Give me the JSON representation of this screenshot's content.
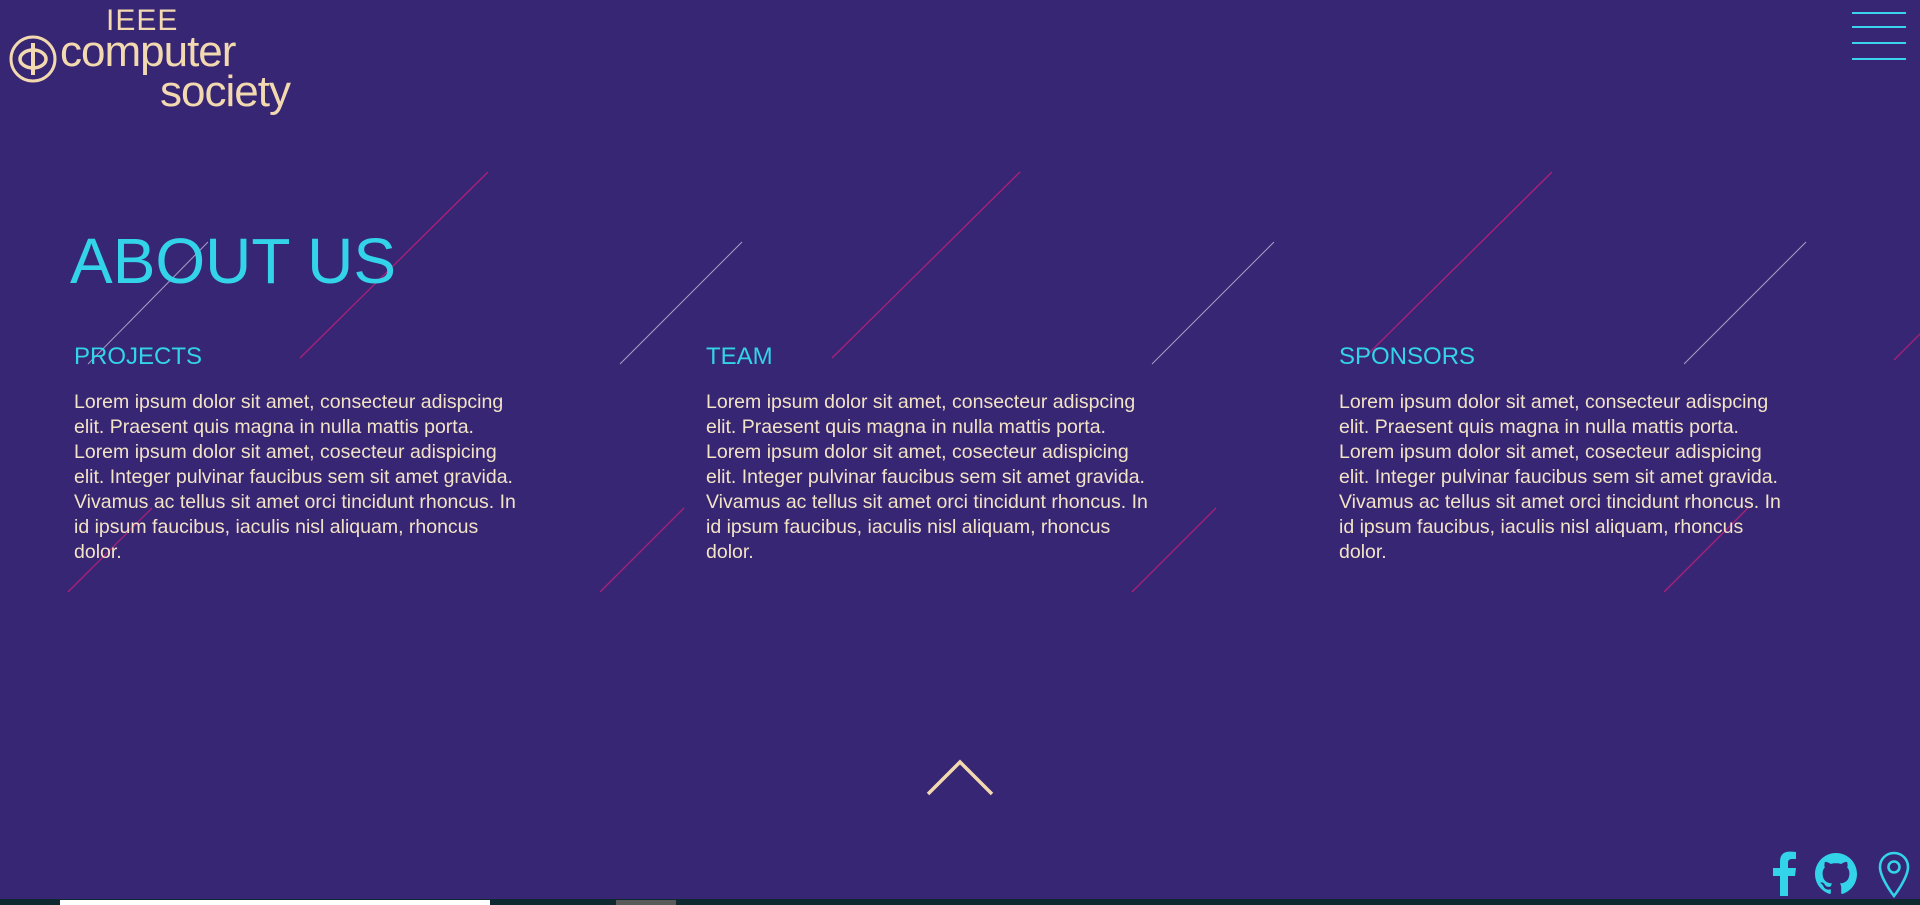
{
  "logo": {
    "line1": "IEEE",
    "line2": "computer",
    "line3": "society",
    "emblem_icon": "ieee-phi-emblem-icon"
  },
  "header": {
    "menu_icon": "hamburger-menu-icon"
  },
  "main": {
    "title": "ABOUT US",
    "columns": [
      {
        "title": "PROJECTS",
        "body": "Lorem ipsum dolor sit amet, consecteur adispcing elit. Praesent quis magna in nulla mattis porta. Lorem ipsum dolor sit amet, cosecteur adispicing elit. Integer pulvinar faucibus sem sit amet gravida. Vivamus ac tellus sit amet orci tincidunt rhoncus. In id ipsum faucibus, iaculis nisl aliquam, rhoncus dolor."
      },
      {
        "title": "TEAM",
        "body": "Lorem ipsum dolor sit amet, consecteur adispcing elit. Praesent quis magna in nulla mattis porta. Lorem ipsum dolor sit amet, cosecteur adispicing elit. Integer pulvinar faucibus sem sit amet gravida. Vivamus ac tellus sit amet orci tincidunt rhoncus. In id ipsum faucibus, iaculis nisl aliquam, rhoncus dolor."
      },
      {
        "title": "SPONSORS",
        "body": "Lorem ipsum dolor sit amet, consecteur adispcing elit. Praesent quis magna in nulla mattis porta. Lorem ipsum dolor sit amet, cosecteur adispicing elit. Integer pulvinar faucibus sem sit amet gravida. Vivamus ac tellus sit amet orci tincidunt rhoncus. In id ipsum faucibus, iaculis nisl aliquam, rhoncus dolor."
      }
    ],
    "scroll_up_icon": "chevron-up-icon"
  },
  "social": {
    "icons": [
      "facebook-icon",
      "github-icon",
      "location-pin-icon"
    ]
  },
  "colors": {
    "background": "#372673",
    "accent_cyan": "#33d3e9",
    "cream": "#f3d9b0",
    "body_text": "#f3e3c6",
    "deco_magenta": "#c0207a",
    "deco_light": "#d8d2e6"
  }
}
